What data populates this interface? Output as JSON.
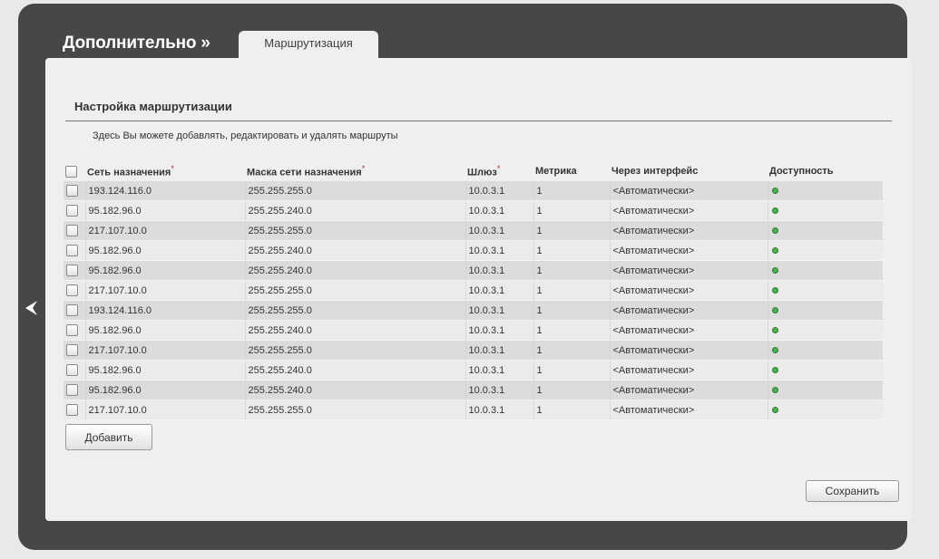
{
  "header": {
    "section_title": "Дополнительно »",
    "active_tab": "Маршрутизация"
  },
  "panel": {
    "heading": "Настройка маршрутизации",
    "description": "Здесь Вы можете добавлять, редактировать и удалять маршруты"
  },
  "table": {
    "columns": [
      "Сеть назначения",
      "Маска сети назначения",
      "Шлюз",
      "Метрика",
      "Через интерфейс",
      "Доступность"
    ],
    "required_marker": "*",
    "rows": [
      {
        "network": "193.124.116.0",
        "mask": "255.255.255.0",
        "gateway": "10.0.3.1",
        "metric": "1",
        "interface": "<Автоматически>",
        "status": "available"
      },
      {
        "network": "95.182.96.0",
        "mask": "255.255.240.0",
        "gateway": "10.0.3.1",
        "metric": "1",
        "interface": "<Автоматически>",
        "status": "available"
      },
      {
        "network": "217.107.10.0",
        "mask": "255.255.255.0",
        "gateway": "10.0.3.1",
        "metric": "1",
        "interface": "<Автоматически>",
        "status": "available"
      },
      {
        "network": "95.182.96.0",
        "mask": "255.255.240.0",
        "gateway": "10.0.3.1",
        "metric": "1",
        "interface": "<Автоматически>",
        "status": "available"
      },
      {
        "network": "95.182.96.0",
        "mask": "255.255.240.0",
        "gateway": "10.0.3.1",
        "metric": "1",
        "interface": "<Автоматически>",
        "status": "available"
      },
      {
        "network": "217.107.10.0",
        "mask": "255.255.255.0",
        "gateway": "10.0.3.1",
        "metric": "1",
        "interface": "<Автоматически>",
        "status": "available"
      },
      {
        "network": "193.124.116.0",
        "mask": "255.255.255.0",
        "gateway": "10.0.3.1",
        "metric": "1",
        "interface": "<Автоматически>",
        "status": "available"
      },
      {
        "network": "95.182.96.0",
        "mask": "255.255.240.0",
        "gateway": "10.0.3.1",
        "metric": "1",
        "interface": "<Автоматически>",
        "status": "available"
      },
      {
        "network": "217.107.10.0",
        "mask": "255.255.255.0",
        "gateway": "10.0.3.1",
        "metric": "1",
        "interface": "<Автоматически>",
        "status": "available"
      },
      {
        "network": "95.182.96.0",
        "mask": "255.255.240.0",
        "gateway": "10.0.3.1",
        "metric": "1",
        "interface": "<Автоматически>",
        "status": "available"
      },
      {
        "network": "95.182.96.0",
        "mask": "255.255.240.0",
        "gateway": "10.0.3.1",
        "metric": "1",
        "interface": "<Автоматически>",
        "status": "available"
      },
      {
        "network": "217.107.10.0",
        "mask": "255.255.255.0",
        "gateway": "10.0.3.1",
        "metric": "1",
        "interface": "<Автоматически>",
        "status": "available"
      }
    ]
  },
  "buttons": {
    "add": "Добавить",
    "save": "Сохранить"
  },
  "icons": {
    "back": "chevron-left-icon",
    "status": "status-dot-icon"
  },
  "colors": {
    "frame": "#474747",
    "panel": "#efefef",
    "status_ok": "#4caf50",
    "required": "#cc2222"
  }
}
